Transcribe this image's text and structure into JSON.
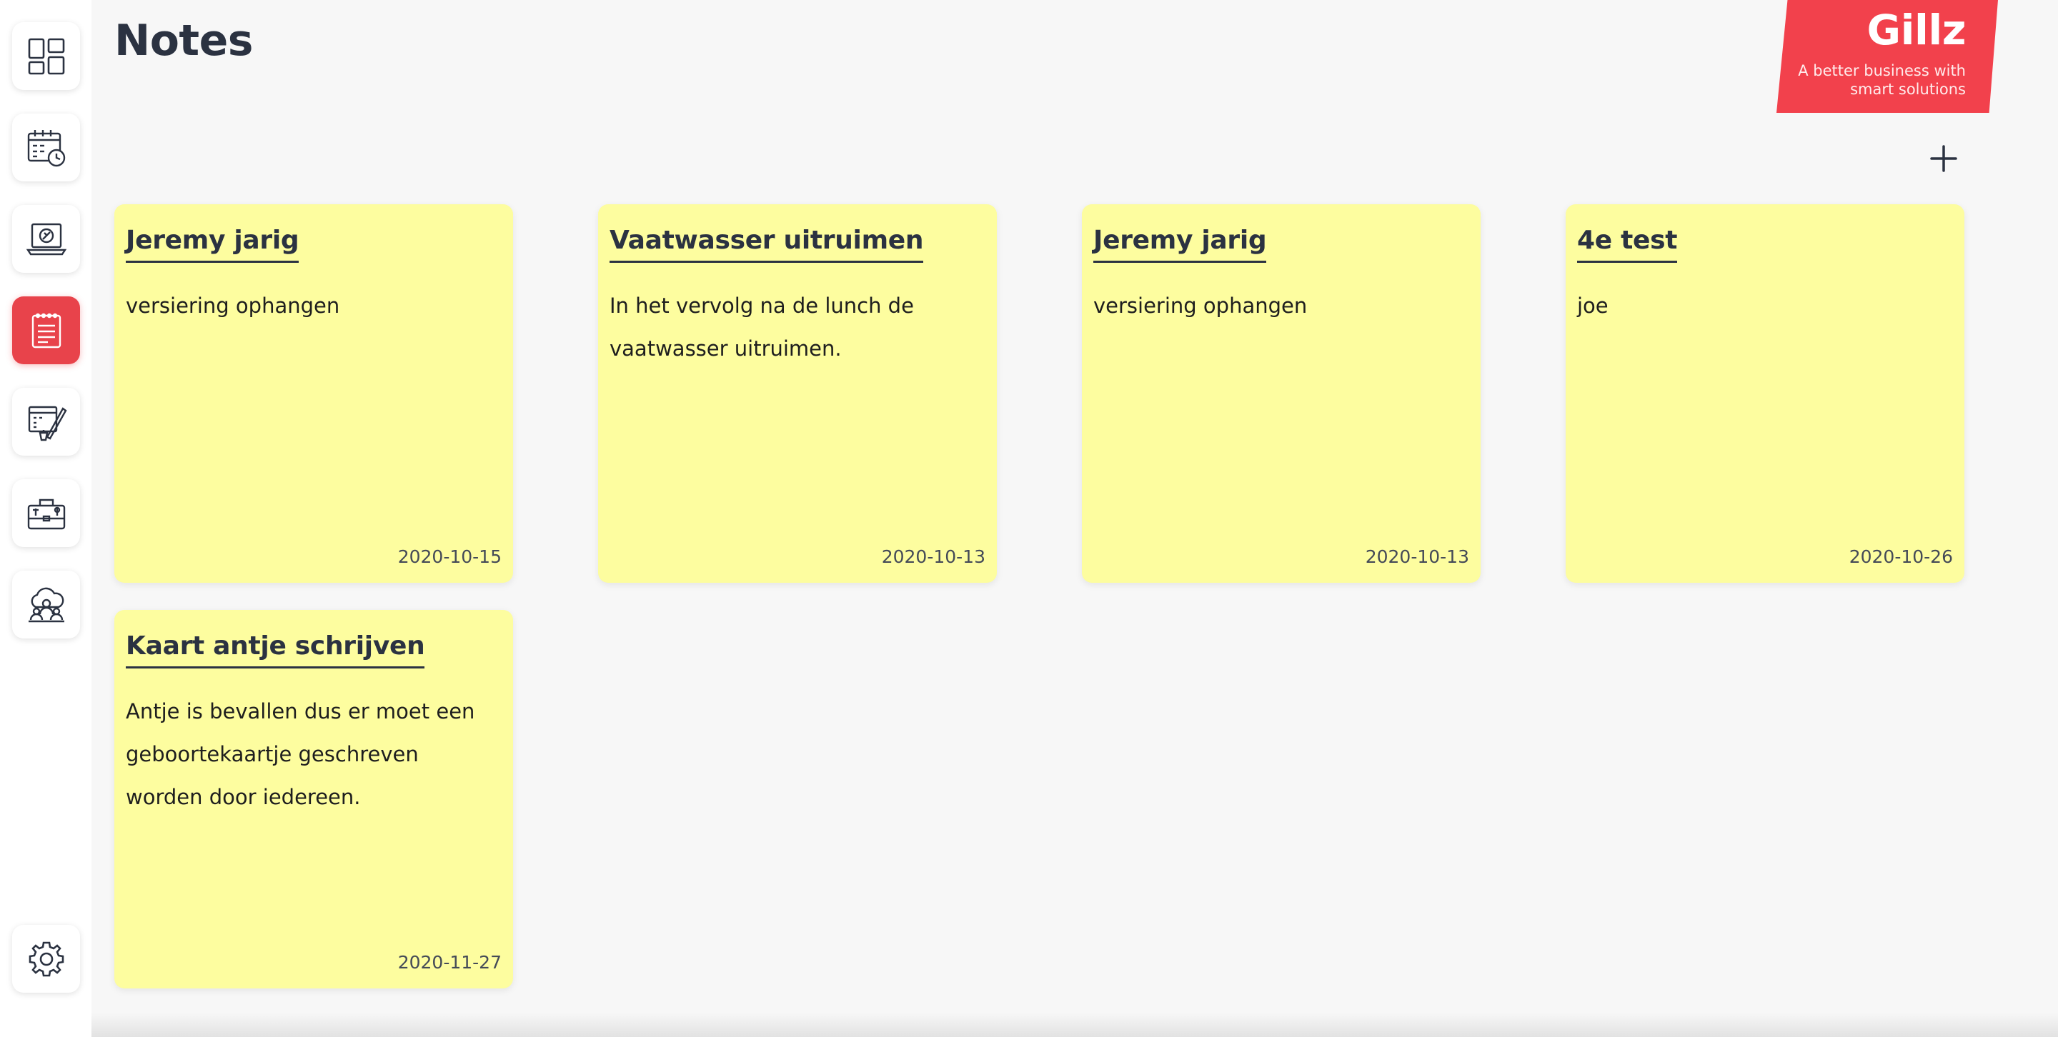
{
  "page": {
    "title": "Notes",
    "add_icon": "plus-icon"
  },
  "brand": {
    "name": "Gillz",
    "tagline": "A better business with smart solutions",
    "color": "#f2414c"
  },
  "sidebar": {
    "items": [
      {
        "icon": "dashboard-icon",
        "active": false
      },
      {
        "icon": "calendar-icon",
        "active": false
      },
      {
        "icon": "laptop-support-icon",
        "active": false
      },
      {
        "icon": "notes-icon",
        "active": true
      },
      {
        "icon": "planner-edit-icon",
        "active": false
      },
      {
        "icon": "toolbox-icon",
        "active": false
      },
      {
        "icon": "cloud-users-icon",
        "active": false
      }
    ],
    "settings_icon": "gear-icon",
    "active_color": "#e8434b"
  },
  "notes": [
    {
      "title": "Jeremy jarig",
      "body": "versiering ophangen",
      "date": "2020-10-15"
    },
    {
      "title": "Vaatwasser uitruimen",
      "body": "In het vervolg na de lunch de vaatwasser uitruimen.",
      "date": "2020-10-13"
    },
    {
      "title": "Jeremy jarig",
      "body": "versiering ophangen",
      "date": "2020-10-13"
    },
    {
      "title": "4e test",
      "body": "joe",
      "date": "2020-10-26"
    },
    {
      "title": "Kaart antje schrijven",
      "body": "Antje is bevallen dus er moet een geboortekaartje geschreven worden door iedereen.",
      "date": "2020-11-27"
    }
  ],
  "colors": {
    "note_background": "#fdfd9f",
    "text_dark": "#2b3241",
    "page_background": "#f7f7f7"
  }
}
